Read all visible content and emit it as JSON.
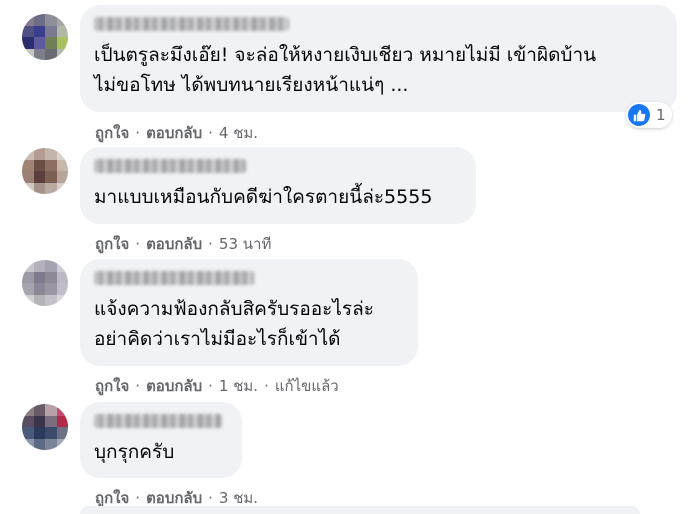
{
  "comments": [
    {
      "text": "เป็นตรูละมึงเอ๊ย! จะล่อให้หงายเงิบเชียว หมายไม่มี เข้าผิดบ้าน\nไม่ขอโทษ ได้พบทนายเรียงหน้าแน่ๆ ...",
      "like_label": "ถูกใจ",
      "reply_label": "ตอบกลับ",
      "time": "4 ชม.",
      "reaction_count": "1",
      "avatar_colors": [
        "#8a7a8e",
        "#6d6d86",
        "#8b8f98",
        "#a9a4a8",
        "#4f4f84",
        "#3b3e8c",
        "#7c7892",
        "#b2b8a8",
        "#2b2e6e",
        "#5d5aa0",
        "#6f7f56",
        "#a8c060",
        "#c4c6c2",
        "#7a7f8a",
        "#6a6a70",
        "#b5b8b1"
      ]
    },
    {
      "text": "มาแบบเหมือนกับคดีฆ่าใครตายนี้ล่ะ5555",
      "like_label": "ถูกใจ",
      "reply_label": "ตอบกลับ",
      "time": "53 นาที",
      "avatar_colors": [
        "#c9bdb5",
        "#b39d92",
        "#c5b4aa",
        "#d8d1cc",
        "#a08474",
        "#6b4f45",
        "#8e6f63",
        "#c7b8ad",
        "#9c8073",
        "#5a4038",
        "#7d6054",
        "#b7a59a",
        "#d2c8c2",
        "#a5928a",
        "#b9aba3",
        "#d6cfca"
      ]
    },
    {
      "text": "แจ้งความฟ้องกลับสิครับรออะไรล่ะ\nอย่าคิดว่าเราไม่มีอะไรก็เข้าได้",
      "like_label": "ถูกใจ",
      "reply_label": "ตอบกลับ",
      "time": "1 ชม.",
      "edited_label": "แก้ไขแล้ว",
      "avatar_colors": [
        "#c8c6cc",
        "#b4b0bc",
        "#a5a3b1",
        "#cfcdd3",
        "#9d9aa8",
        "#7f7b8c",
        "#8d8a96",
        "#bcb9c2",
        "#a7a4ae",
        "#8b8796",
        "#9a97a3",
        "#c1bec7",
        "#d0cfd3",
        "#b5b3ba",
        "#c4c2c8",
        "#d8d7da"
      ]
    },
    {
      "text": "บุกรุกครับ",
      "like_label": "ถูกใจ",
      "reply_label": "ตอบกลับ",
      "time": "3 ชม.",
      "avatar_colors": [
        "#8b7f86",
        "#6b5a6a",
        "#b8a0a8",
        "#c84a6a",
        "#5a4e62",
        "#3a344c",
        "#7c6e7e",
        "#b22a4a",
        "#4a5a7a",
        "#2a3a5c",
        "#3c4a6c",
        "#6a7284",
        "#8a96aa",
        "#5c6a86",
        "#7a8498",
        "#a0a8b8"
      ]
    }
  ]
}
